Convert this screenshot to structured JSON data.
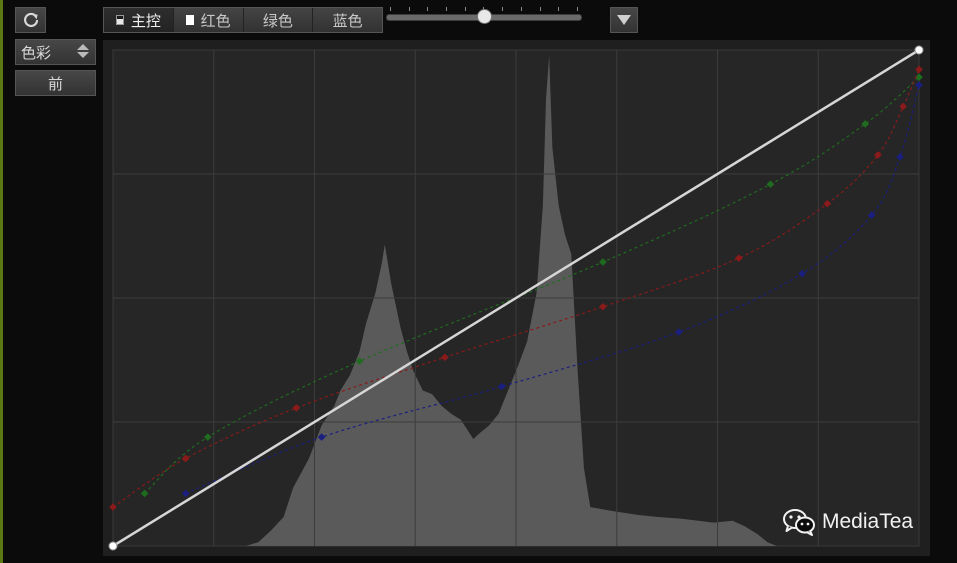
{
  "toolbar": {
    "mode_select_value": "色彩",
    "before_label": "前",
    "tabs": [
      {
        "label": "主控",
        "active": true
      },
      {
        "label": "红色",
        "active": false
      },
      {
        "label": "绿色",
        "active": false
      },
      {
        "label": "蓝色",
        "active": false
      }
    ],
    "slider_value": 0.5
  },
  "watermark": {
    "text": "MediaTea"
  },
  "colors": {
    "background": "#0b0b0b",
    "panel": "#1f1f1f",
    "grid_area": "#262626",
    "histogram": "#5a5a5a",
    "master_curve": "#d6d6d6",
    "red_curve": "#8b1a1a",
    "green_curve": "#1f6b1f",
    "blue_curve": "#1a1f80"
  },
  "icons": {
    "reset": "refresh-icon",
    "mode_select": "updown-arrows-icon",
    "dropdown": "triangle-down-icon",
    "watermark": "wechat-icon"
  },
  "chart_data": {
    "type": "area",
    "xlim": [
      0,
      255
    ],
    "ylim": [
      0,
      255
    ],
    "grid": true,
    "histogram": [
      [
        0,
        0
      ],
      [
        42,
        0
      ],
      [
        46,
        2
      ],
      [
        50,
        8
      ],
      [
        54,
        15
      ],
      [
        57,
        30
      ],
      [
        62,
        45
      ],
      [
        66,
        62
      ],
      [
        70,
        72
      ],
      [
        72,
        80
      ],
      [
        75,
        88
      ],
      [
        78,
        100
      ],
      [
        80,
        114
      ],
      [
        83,
        130
      ],
      [
        85,
        145
      ],
      [
        86,
        155
      ],
      [
        88,
        135
      ],
      [
        91,
        112
      ],
      [
        93,
        100
      ],
      [
        95,
        90
      ],
      [
        98,
        80
      ],
      [
        101,
        78
      ],
      [
        104,
        72
      ],
      [
        107,
        68
      ],
      [
        110,
        65
      ],
      [
        112,
        60
      ],
      [
        114,
        55
      ],
      [
        116,
        58
      ],
      [
        119,
        62
      ],
      [
        122,
        68
      ],
      [
        125,
        80
      ],
      [
        128,
        92
      ],
      [
        131,
        105
      ],
      [
        134,
        130
      ],
      [
        136,
        175
      ],
      [
        137,
        230
      ],
      [
        138,
        252
      ],
      [
        139,
        205
      ],
      [
        141,
        175
      ],
      [
        143,
        160
      ],
      [
        145,
        150
      ],
      [
        147,
        90
      ],
      [
        149,
        40
      ],
      [
        151,
        20
      ],
      [
        158,
        18
      ],
      [
        166,
        16
      ],
      [
        172,
        15
      ],
      [
        180,
        14
      ],
      [
        190,
        12
      ],
      [
        196,
        13
      ],
      [
        200,
        10
      ],
      [
        204,
        6
      ],
      [
        207,
        2
      ],
      [
        210,
        0
      ],
      [
        255,
        0
      ]
    ],
    "series": [
      {
        "name": "",
        "color": "#d6d6d6",
        "points": [
          [
            0,
            0
          ],
          [
            255,
            255
          ]
        ]
      },
      {
        "name": "",
        "color": "#8b1a1a",
        "points": [
          [
            0,
            20
          ],
          [
            23,
            45
          ],
          [
            58,
            71
          ],
          [
            105,
            97
          ],
          [
            155,
            123
          ],
          [
            198,
            148
          ],
          [
            226,
            176
          ],
          [
            242,
            201
          ],
          [
            250,
            226
          ],
          [
            255,
            245
          ]
        ]
      },
      {
        "name": "",
        "color": "#1f6b1f",
        "points": [
          [
            10,
            27
          ],
          [
            30,
            56
          ],
          [
            78,
            95
          ],
          [
            155,
            146
          ],
          [
            208,
            186
          ],
          [
            238,
            217
          ],
          [
            255,
            241
          ]
        ]
      },
      {
        "name": "",
        "color": "#1a1f80",
        "points": [
          [
            23,
            27
          ],
          [
            66,
            56
          ],
          [
            123,
            82
          ],
          [
            179,
            110
          ],
          [
            218,
            140
          ],
          [
            240,
            170
          ],
          [
            249,
            200
          ],
          [
            255,
            237
          ]
        ]
      }
    ]
  }
}
